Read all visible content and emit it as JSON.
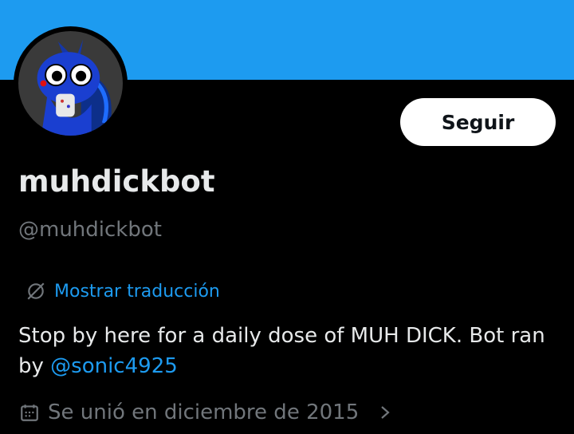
{
  "profile": {
    "display_name": "muhdickbot",
    "handle": "@muhdickbot",
    "follow_label": "Seguir",
    "translate_label": "Mostrar traducción",
    "bio_text": "Stop by here for a daily dose of MUH DICK. Bot ran by ",
    "bio_mention": "@sonic4925",
    "joined_text": "Se unió en diciembre de 2015"
  },
  "colors": {
    "banner": "#1d9bf0",
    "background": "#000000",
    "accent": "#1d9bf0",
    "muted": "#71767b"
  },
  "icons": {
    "translate": "globe-slash-icon",
    "calendar": "calendar-icon",
    "chevron": "chevron-right-icon"
  }
}
